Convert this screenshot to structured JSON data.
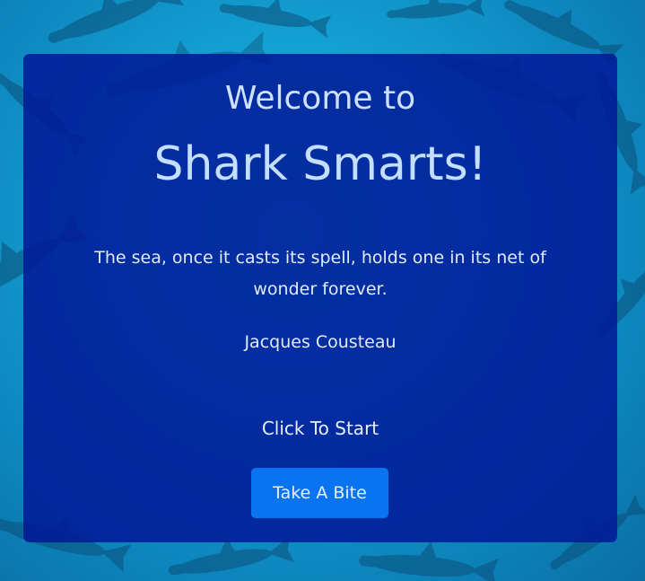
{
  "background": {
    "description_icon": "shark-school-background",
    "color": "#14a3d4"
  },
  "card": {
    "welcome": "Welcome to",
    "title": "Shark Smarts!",
    "quote": "The sea, once it casts its spell, holds one in its net of wonder forever.",
    "author": "Jacques Cousteau",
    "prompt": "Click To Start",
    "button_label": "Take A Bite"
  },
  "colors": {
    "card_bg": "#001996",
    "button_bg": "#0a74f0",
    "title_text": "#c4deff"
  }
}
